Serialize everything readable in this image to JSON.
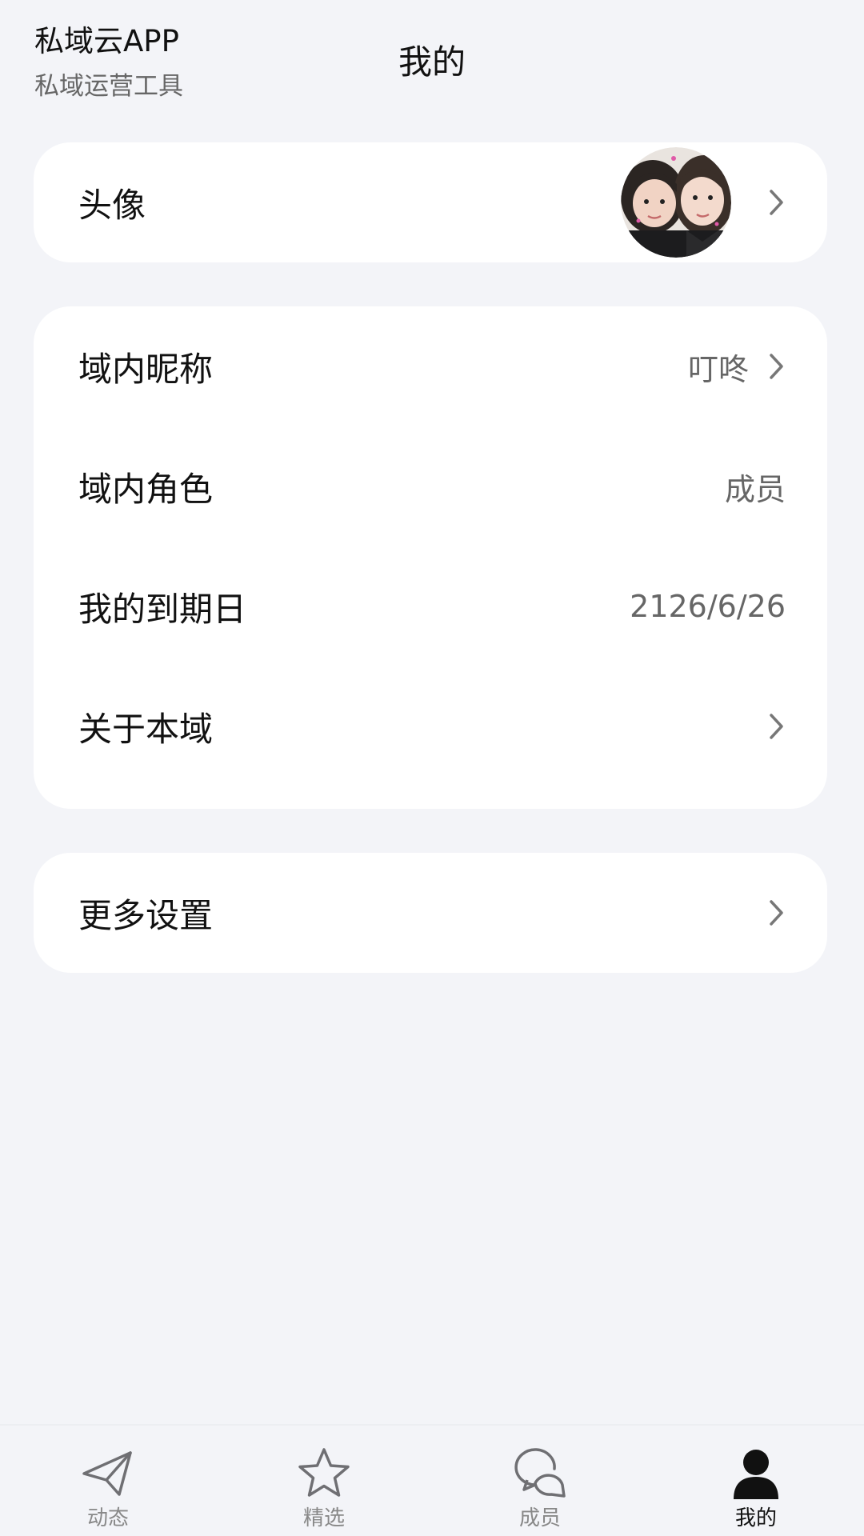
{
  "app": {
    "name": "私域云APP",
    "subtitle": "私域运营工具"
  },
  "header": {
    "title": "我的"
  },
  "profile": {
    "avatar_label": "头像",
    "avatar_icon": "user-photo"
  },
  "info": {
    "nickname": {
      "label": "域内昵称",
      "value": "叮咚"
    },
    "role": {
      "label": "域内角色",
      "value": "成员"
    },
    "expiry": {
      "label": "我的到期日",
      "value": "2126/6/26"
    },
    "about": {
      "label": "关于本域"
    }
  },
  "settings": {
    "more_label": "更多设置"
  },
  "tabbar": {
    "items": [
      {
        "label": "动态",
        "icon": "paper-plane-icon",
        "active": false
      },
      {
        "label": "精选",
        "icon": "star-icon",
        "active": false
      },
      {
        "label": "成员",
        "icon": "chat-bubbles-icon",
        "active": false
      },
      {
        "label": "我的",
        "icon": "person-icon",
        "active": true
      }
    ]
  },
  "colors": {
    "background": "#f3f4f8",
    "card": "#ffffff",
    "text": "#111111",
    "secondary": "#666666",
    "tab_inactive": "#888888"
  }
}
